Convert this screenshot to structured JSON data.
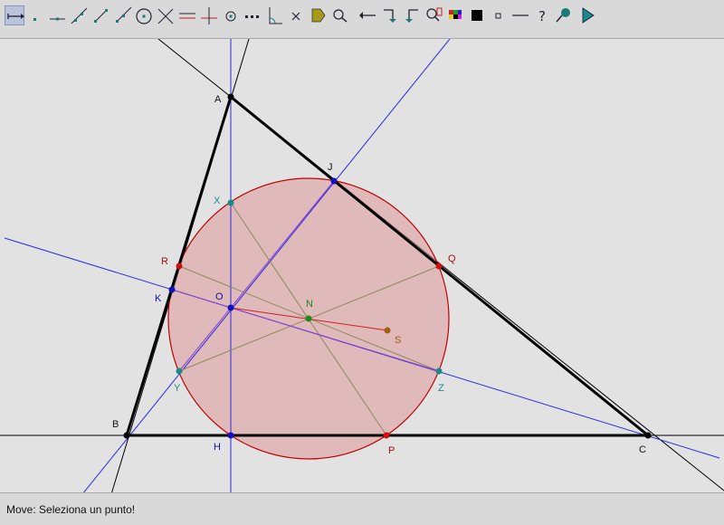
{
  "toolbar": {
    "tools": [
      {
        "name": "move-tool-icon",
        "selected": true
      },
      {
        "name": "point-tool-icon"
      },
      {
        "name": "point-on-line-tool-icon"
      },
      {
        "name": "line-tool-icon"
      },
      {
        "name": "segment-tool-icon"
      },
      {
        "name": "ray-tool-icon"
      },
      {
        "name": "circle-tool-icon"
      },
      {
        "name": "intersection-tool-icon"
      },
      {
        "name": "parallel-tool-icon"
      },
      {
        "name": "perpendicular-tool-icon"
      },
      {
        "name": "midpoint-tool-icon"
      },
      {
        "name": "dotted-line-tool-icon"
      },
      {
        "name": "angle-tool-icon"
      },
      {
        "name": "delete-tool-icon"
      },
      {
        "name": "label-tool-icon"
      },
      {
        "name": "magnifier-tool-icon"
      },
      {
        "name": "undo-arrow-icon"
      },
      {
        "name": "redo-right-icon"
      },
      {
        "name": "redo-left-icon"
      },
      {
        "name": "zoom-tool-icon"
      },
      {
        "name": "color-palette-icon"
      },
      {
        "name": "fill-square-icon"
      },
      {
        "name": "point-size-icon"
      },
      {
        "name": "line-style-icon"
      },
      {
        "name": "help-icon"
      },
      {
        "name": "pin-tool-icon"
      },
      {
        "name": "play-triangle-icon"
      }
    ]
  },
  "colors": {
    "vertex": "#000000",
    "circle_stroke": "#c00000",
    "circle_fill": "#e0a0a0",
    "blue_line": "#2a2ae0",
    "olive_line": "#8a8a5a",
    "purple_line": "#8a40d0",
    "red_segment": "#d02020",
    "teal_point": "#1a8a8a",
    "green_point": "#1a8a1a",
    "brown_point": "#a06010"
  },
  "points": {
    "A": "A",
    "B": "B",
    "C": "C",
    "J": "J",
    "Q": "Q",
    "X": "X",
    "R": "R",
    "K": "K",
    "O": "O",
    "N": "N",
    "S": "S",
    "Y": "Y",
    "Z": "Z",
    "H": "H",
    "P": "P"
  },
  "status": {
    "text": "Move: Seleziona un punto!"
  }
}
